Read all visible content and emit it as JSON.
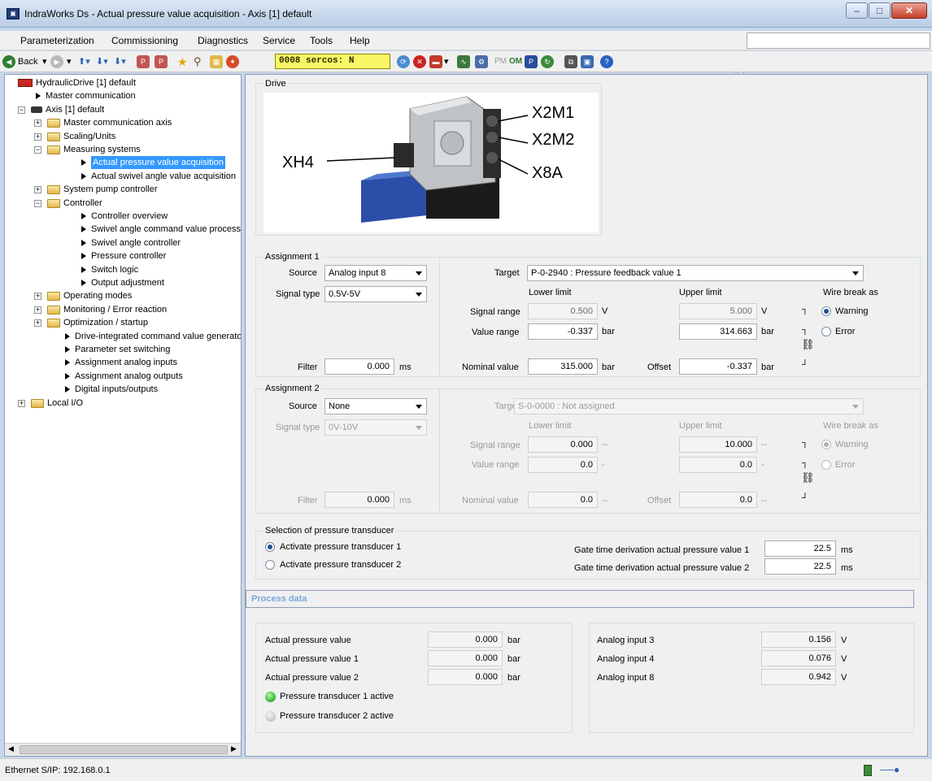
{
  "window": {
    "title": "IndraWorks Ds - Actual pressure value acquisition - Axis [1] default"
  },
  "menu": [
    "Parameterization",
    "Commissioning",
    "Diagnostics",
    "Service",
    "Tools",
    "Help"
  ],
  "toolbar": {
    "back": "Back",
    "sercos": "0008 sercos: N",
    "pm": "PM",
    "om": "OM"
  },
  "tree": [
    {
      "label": "HydraulicDrive [1] default"
    },
    {
      "label": "Master communication"
    },
    {
      "label": "Axis [1] default"
    },
    {
      "label": "Master communication axis"
    },
    {
      "label": "Scaling/Units"
    },
    {
      "label": "Measuring systems"
    },
    {
      "label": "Actual pressure value acquisition"
    },
    {
      "label": "Actual swivel angle value acquisition"
    },
    {
      "label": "System pump controller"
    },
    {
      "label": "Controller"
    },
    {
      "label": "Controller overview"
    },
    {
      "label": "Swivel angle command value process"
    },
    {
      "label": "Swivel angle controller"
    },
    {
      "label": "Pressure controller"
    },
    {
      "label": "Switch logic"
    },
    {
      "label": "Output adjustment"
    },
    {
      "label": "Operating modes"
    },
    {
      "label": "Monitoring / Error reaction"
    },
    {
      "label": "Optimization / startup"
    },
    {
      "label": "Drive-integrated command value generato"
    },
    {
      "label": "Parameter set switching"
    },
    {
      "label": "Assignment analog inputs"
    },
    {
      "label": "Assignment analog outputs"
    },
    {
      "label": "Digital inputs/outputs"
    },
    {
      "label": "Local I/O"
    }
  ],
  "drive": {
    "title": "Drive",
    "labels": {
      "x2m1": "X2M1",
      "x2m2": "X2M2",
      "x8a": "X8A",
      "xh4": "XH4"
    }
  },
  "common": {
    "source": "Source",
    "signal_type": "Signal type",
    "target": "Target",
    "lower_limit": "Lower limit",
    "upper_limit": "Upper limit",
    "wire_break": "Wire break as",
    "signal_range": "Signal range",
    "value_range": "Value range",
    "filter": "Filter",
    "nominal_value": "Nominal value",
    "offset": "Offset",
    "warning": "Warning",
    "error": "Error"
  },
  "assignment1": {
    "title": "Assignment 1",
    "source": "Analog input 8",
    "signal_type": "0.5V-5V",
    "target": "P-0-2940 :  Pressure feedback value 1",
    "signal_lower": "0.500",
    "signal_upper": "5.000",
    "signal_unit": "V",
    "value_lower": "-0.337",
    "value_upper": "314.663",
    "value_unit": "bar",
    "filter": "0.000",
    "filter_unit": "ms",
    "nominal": "315.000",
    "nominal_unit": "bar",
    "offset": "-0.337",
    "offset_unit": "bar",
    "wire_break": "Warning"
  },
  "assignment2": {
    "title": "Assignment 2",
    "source": "None",
    "signal_type": "0V-10V",
    "target": "S-0-0000 :  Not assigned",
    "signal_lower": "0.000",
    "signal_upper": "10.000",
    "signal_unit": "--",
    "value_lower": "0.0",
    "value_upper": "0.0",
    "value_unit": "-",
    "filter": "0.000",
    "filter_unit": "ms",
    "nominal": "0.0",
    "nominal_unit": "--",
    "offset": "0.0",
    "offset_unit": "--",
    "wire_break": "Warning"
  },
  "transducer": {
    "title": "Selection of pressure transducer",
    "opt1": "Activate pressure transducer 1",
    "opt2": "Activate pressure transducer 2",
    "gate1_label": "Gate time derivation actual pressure value 1",
    "gate1_value": "22.5",
    "gate2_label": "Gate time derivation actual pressure value 2",
    "gate2_value": "22.5",
    "unit": "ms",
    "selected": "Activate pressure transducer 1"
  },
  "process": {
    "header": "Process data",
    "rows": [
      {
        "label": "Actual pressure value",
        "value": "0.000",
        "unit": "bar"
      },
      {
        "label": "Actual pressure value 1",
        "value": "0.000",
        "unit": "bar"
      },
      {
        "label": "Actual pressure value 2",
        "value": "0.000",
        "unit": "bar"
      }
    ],
    "led1": "Pressure transducer 1 active",
    "led2": "Pressure transducer 2 active",
    "analog": [
      {
        "label": "Analog input 3",
        "value": "0.156",
        "unit": "V"
      },
      {
        "label": "Analog input 4",
        "value": "0.076",
        "unit": "V"
      },
      {
        "label": "Analog input 8",
        "value": "0.942",
        "unit": "V"
      }
    ]
  },
  "status": {
    "connection": "Ethernet S/IP: 192.168.0.1"
  },
  "colors": {
    "selection": "#3399ff",
    "led_active": "#3fbf3f",
    "led_inactive": "#cfcfcf",
    "sercos_bg": "#f7f766"
  }
}
